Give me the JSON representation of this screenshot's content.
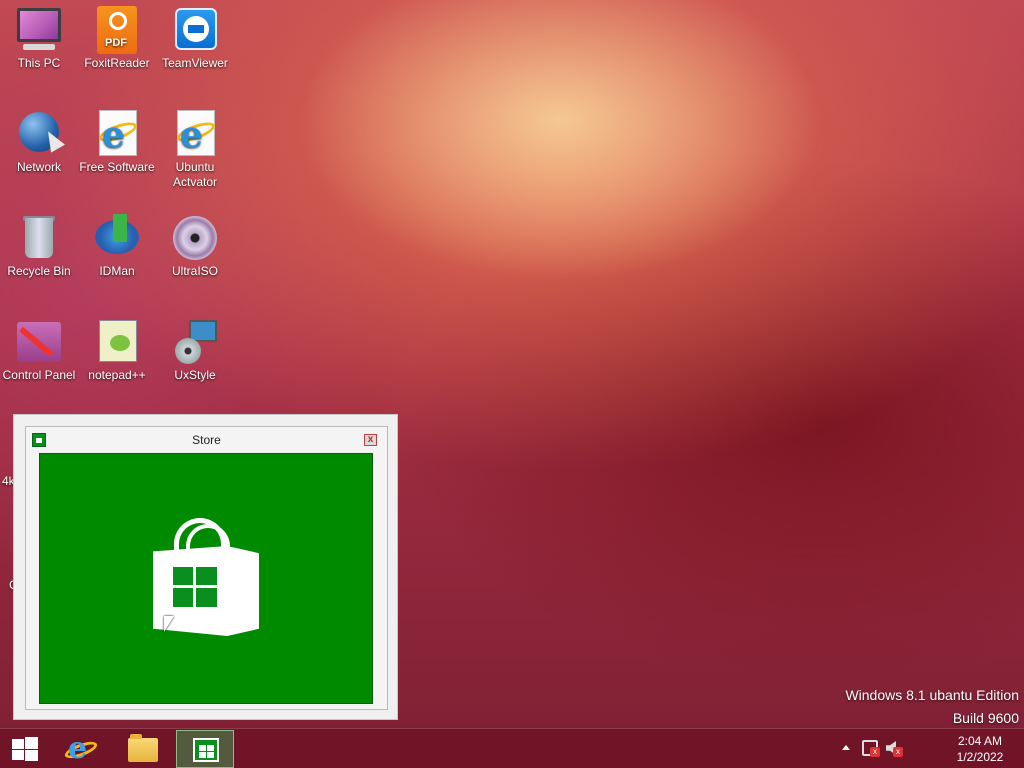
{
  "desktop": {
    "icons": [
      {
        "label": "This PC"
      },
      {
        "label": "FoxitReader"
      },
      {
        "label": "TeamViewer"
      },
      {
        "label": "Network"
      },
      {
        "label": "Free Software"
      },
      {
        "label": "Ubuntu Actvator"
      },
      {
        "label": "Recycle Bin"
      },
      {
        "label": "IDMan"
      },
      {
        "label": "UltraISO"
      },
      {
        "label": "Control Panel"
      },
      {
        "label": "notepad++"
      },
      {
        "label": "UxStyle"
      }
    ],
    "partial_left_text_1": "4k",
    "partial_left_text_2": "C"
  },
  "store_window": {
    "title": "Store",
    "close_label": "x",
    "app_color": "#008a00"
  },
  "watermark": {
    "line1": "Windows 8.1 ubantu Edition",
    "line2": "Build 9600"
  },
  "taskbar": {
    "buttons": [
      {
        "icon": "start-windows-icon"
      },
      {
        "icon": "internet-explorer-icon"
      },
      {
        "icon": "file-explorer-icon"
      },
      {
        "icon": "store-icon",
        "active": true
      }
    ],
    "tray": {
      "network_status_mark": "x",
      "volume_status_mark": "x"
    },
    "clock": {
      "time": "2:04 AM",
      "date": "1/2/2022"
    }
  }
}
